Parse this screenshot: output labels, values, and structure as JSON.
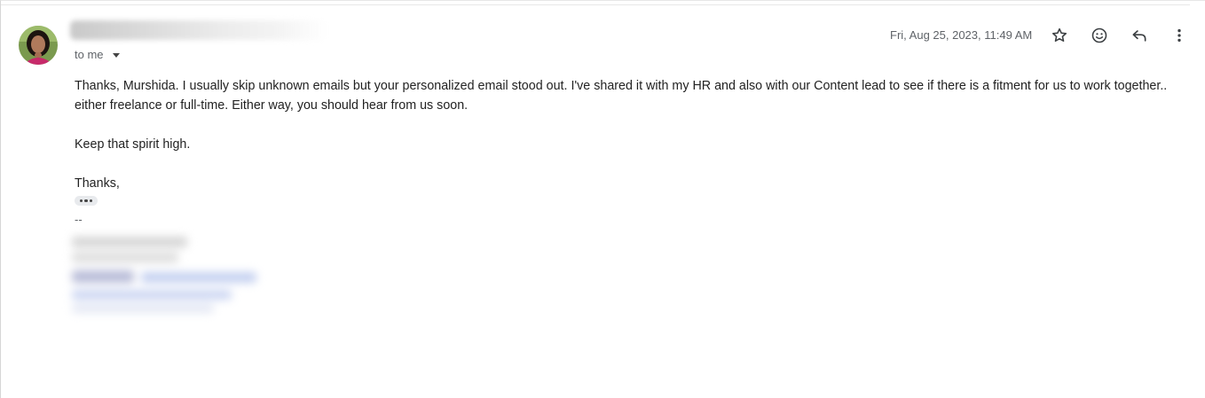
{
  "header": {
    "recipient_label": "to me",
    "timestamp": "Fri, Aug 25, 2023, 11:49 AM"
  },
  "actions": {
    "star_icon": "star-icon",
    "emoji_icon": "emoji-reaction-icon",
    "reply_icon": "reply-icon",
    "more_icon": "more-options-icon"
  },
  "body": {
    "paragraph1_line1": "Thanks, Murshida. I usually skip unknown emails but your personalized email stood out. I've shared it with my HR and also with our Content lead to see if there is a fitment for us to work together..",
    "paragraph1_line2": "either freelance or full-time. Either way, you should hear from us soon.",
    "paragraph2": "Keep that spirit high.",
    "closing": "Thanks,",
    "signature_separator": "--"
  },
  "colors": {
    "text": "#222222",
    "muted": "#5f6368",
    "link_blur": "#aab8e8"
  }
}
